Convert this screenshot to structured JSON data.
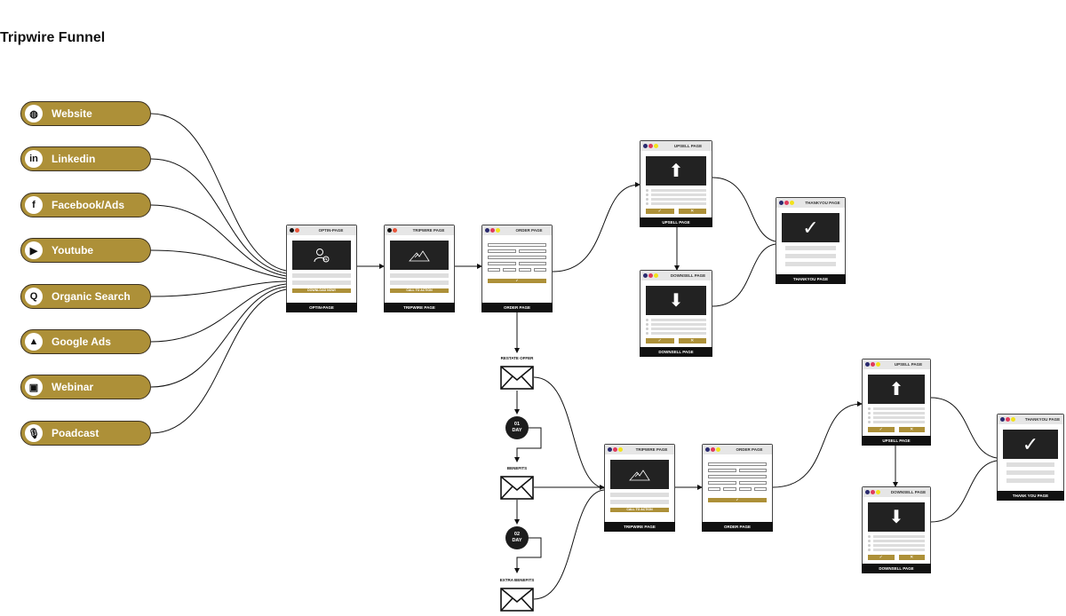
{
  "title": "Tripwire Funnel",
  "colors": {
    "gold": "#ad9038",
    "dark": "#1c1c1c",
    "dot_blue": "#2a2a6e",
    "dot_red": "#e03a5c",
    "dot_yellow": "#f2e21a",
    "dot_black": "#111111",
    "dot_orange": "#e8553a"
  },
  "sources": [
    {
      "label": "Website",
      "icon": "globe-icon",
      "glyph": "◍"
    },
    {
      "label": "Linkedin",
      "icon": "linkedin-icon",
      "glyph": "in"
    },
    {
      "label": "Facebook/Ads",
      "icon": "facebook-icon",
      "glyph": "f"
    },
    {
      "label": "Youtube",
      "icon": "youtube-icon",
      "glyph": "▶"
    },
    {
      "label": "Organic Search",
      "icon": "search-icon",
      "glyph": "Q"
    },
    {
      "label": "Google Ads",
      "icon": "google-ads-icon",
      "glyph": "▲"
    },
    {
      "label": "Webinar",
      "icon": "webinar-icon",
      "glyph": "▣"
    },
    {
      "label": "Poadcast",
      "icon": "microphone-icon",
      "glyph": "🎙"
    }
  ],
  "pages": {
    "optin": {
      "title": "OPTIN-PAGE",
      "cta": "DOWNLOAD NOW!",
      "footer": "OPTIN-PAGE"
    },
    "tripwire1": {
      "title": "TRIPWIRE PAGE",
      "cta": "CALL TO ACTION",
      "footer": "TRIPWIRE PAGE"
    },
    "order1": {
      "title": "ORDER PAGE",
      "cta": "✓",
      "footer": "ORDER PAGE"
    },
    "upsell1": {
      "title": "UPSELL PAGE",
      "yes": "✓",
      "no": "✕",
      "footer": "UPSELL PAGE"
    },
    "downsell1": {
      "title": "DOWNSELL PAGE",
      "yes": "✓",
      "no": "✕",
      "footer": "DOWNSELL PAGE"
    },
    "thankyou1": {
      "title": "THANKYOU PAGE",
      "footer": "THANKYOU PAGE"
    },
    "tripwire2": {
      "title": "TRIPWIRE PAGE",
      "cta": "CALL TO ACTION",
      "footer": "TRIPWIRE PAGE"
    },
    "order2": {
      "title": "ORDER PAGE",
      "cta": "✓",
      "footer": "ORDER PAGE"
    },
    "upsell2": {
      "title": "UPSELL PAGE",
      "yes": "✓",
      "no": "✕",
      "footer": "UPSELL PAGE"
    },
    "downsell2": {
      "title": "DOWNSELL PAGE",
      "yes": "✓",
      "no": "✕",
      "footer": "DOWNSELL PAGE"
    },
    "thankyou2": {
      "title": "THANKYOU PAGE",
      "footer": "THANK YOU PAGE"
    }
  },
  "emails": {
    "restate": "RESTATE OFFER",
    "benefits": "BENEFITS",
    "extra": "EXTRA BENEFITS"
  },
  "delays": {
    "day1": {
      "num": "01",
      "unit": "DAY"
    },
    "day2": {
      "num": "02",
      "unit": "DAY"
    }
  }
}
